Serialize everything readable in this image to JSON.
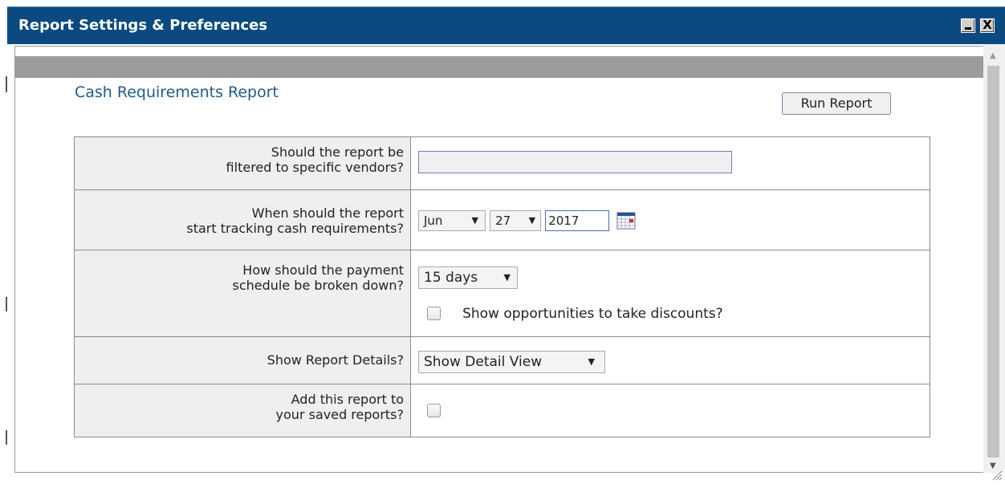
{
  "window": {
    "title": "Report Settings & Preferences",
    "close_symbol": "X",
    "icons": {
      "minimize": "minimize-icon",
      "close": "close-icon"
    }
  },
  "report": {
    "title": "Cash Requirements Report",
    "run_label": "Run Report"
  },
  "rows": {
    "vendors": {
      "label_line1": "Should the report be",
      "label_line2": "filtered to specific vendors?",
      "value": ""
    },
    "start": {
      "label_line1": "When should the report",
      "label_line2": "start tracking cash requirements?",
      "month": "Jun",
      "day": "27",
      "year": "2017",
      "icon": "calendar-icon"
    },
    "schedule": {
      "label_line1": "How should the payment",
      "label_line2": "schedule be broken down?",
      "period": "15 days",
      "discount_label": "Show opportunities to take discounts?",
      "discount_checked": false
    },
    "details": {
      "label": "Show Report Details?",
      "value": "Show Detail View"
    },
    "saved": {
      "label_line1": "Add this report to",
      "label_line2": "your saved reports?",
      "checked": false
    }
  },
  "dropdown_arrow": "▼",
  "scroll_up_arrow": "▲",
  "scroll_down_arrow": "▼"
}
